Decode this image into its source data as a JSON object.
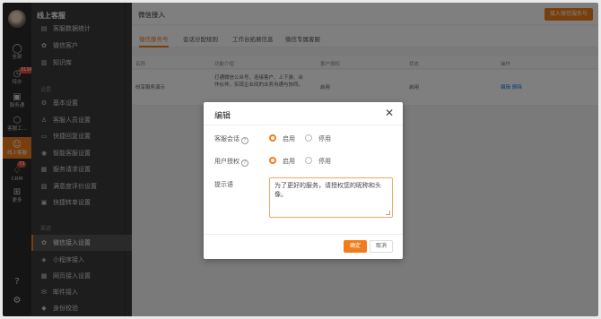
{
  "rail": {
    "items": [
      {
        "label": "全部",
        "icon": "chat-icon"
      },
      {
        "label": "待办",
        "icon": "clock-icon",
        "badge": "3134"
      },
      {
        "label": "服务通",
        "icon": "service-icon"
      },
      {
        "label": "客服工...",
        "icon": "cube-icon"
      },
      {
        "label": "线上客服",
        "icon": "headset-icon"
      },
      {
        "label": "CRM",
        "icon": "crm-icon",
        "badge": "73"
      },
      {
        "label": "更多",
        "icon": "grid-icon"
      }
    ]
  },
  "sidebar": {
    "brand": "线上客服",
    "items_top": [
      {
        "label": "客服数据统计",
        "icon": "chart-icon"
      },
      {
        "label": "微信客户",
        "icon": "wechat-icon"
      },
      {
        "label": "知识库",
        "icon": "book-icon"
      }
    ],
    "group_settings": "设置",
    "items_settings": [
      {
        "label": "基本设置",
        "icon": "gear-icon"
      },
      {
        "label": "客服人员设置",
        "icon": "people-icon"
      },
      {
        "label": "快捷回复设置",
        "icon": "reply-icon"
      },
      {
        "label": "智能客服设置",
        "icon": "bot-icon"
      },
      {
        "label": "服务请求设置",
        "icon": "request-icon"
      },
      {
        "label": "满意度评价设置",
        "icon": "rating-icon"
      },
      {
        "label": "快捷转单设置",
        "icon": "transfer-icon"
      }
    ],
    "group_channels": "渠道",
    "items_channels": [
      {
        "label": "微信接入设置",
        "icon": "wechat-icon",
        "active": true
      },
      {
        "label": "小程序接入",
        "icon": "miniprogram-icon"
      },
      {
        "label": "网页接入设置",
        "icon": "web-icon"
      },
      {
        "label": "邮件接入",
        "icon": "mail-icon"
      },
      {
        "label": "身份校验",
        "icon": "shield-icon"
      }
    ]
  },
  "header": {
    "title": "微信接入",
    "action_button": "接入微信服务号"
  },
  "tabs": [
    "微信服务号",
    "会话分配规则",
    "工作台拓展信息",
    "微信专属客服"
  ],
  "table": {
    "columns": [
      "名称",
      "功能介绍",
      "客户授权",
      "状态",
      "操作"
    ],
    "rows": [
      {
        "name": "纷享服务演示",
        "intro": "打通微信公众号，连接客户、上下游、合作伙伴，实现企业间的业务沟通与协同。",
        "auth": "启用",
        "status": "启用",
        "action_edit": "编辑",
        "action_delete": "删除"
      }
    ]
  },
  "dialog": {
    "title": "编辑",
    "session_label": "客服会话",
    "auth_label": "用户授权",
    "greeting_label": "提示语",
    "option_on": "启用",
    "option_off": "停用",
    "session_value": "启用",
    "auth_value": "启用",
    "greeting_text": "为了更好的服务，请授权您的昵称和头像。",
    "ok": "确定",
    "cancel": "取消"
  },
  "colors": {
    "accent": "#f07d1a",
    "link": "#1f74d6",
    "rail_bg": "#2b2b2b",
    "sidebar_bg": "#3a3a3a"
  }
}
